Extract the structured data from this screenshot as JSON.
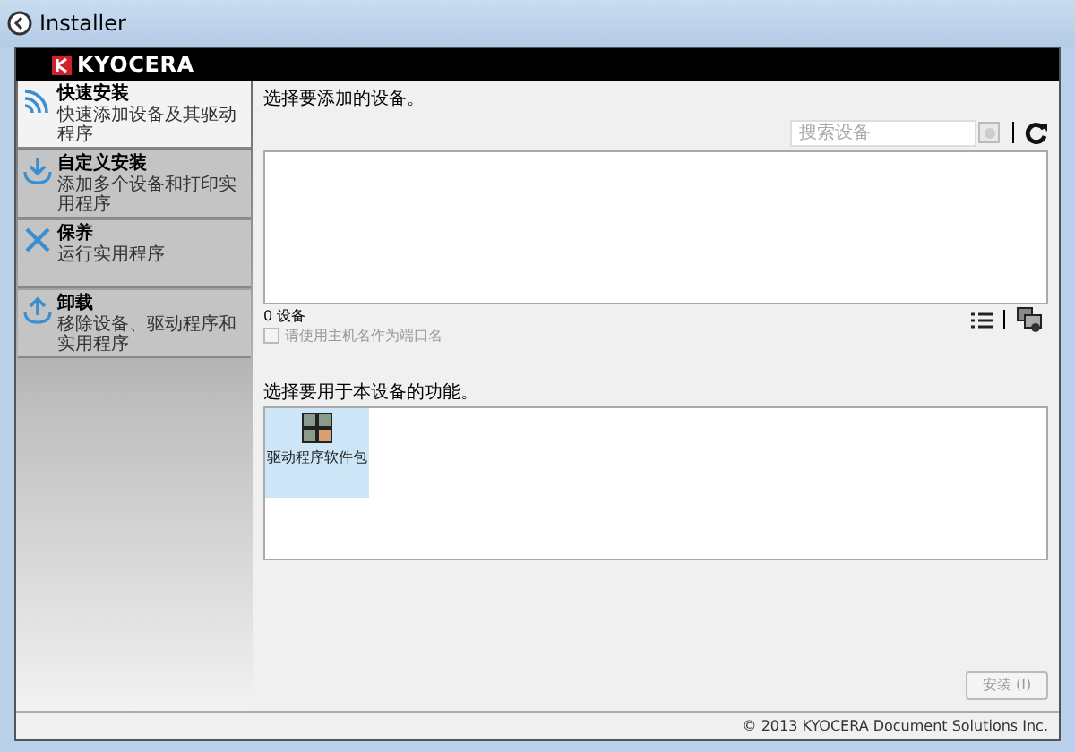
{
  "window": {
    "title": "Installer"
  },
  "logo": {
    "text": "KYOCERA"
  },
  "sidebar": {
    "items": [
      {
        "title": "快速安装",
        "subtitle": "快速添加设备及其驱动程序",
        "selected": true
      },
      {
        "title": "自定义安装",
        "subtitle": "添加多个设备和打印实用程序",
        "selected": false
      },
      {
        "title": "保养",
        "subtitle": "运行实用程序",
        "selected": false
      },
      {
        "title": "卸载",
        "subtitle": "移除设备、驱动程序和实用程序",
        "selected": false
      }
    ]
  },
  "devices": {
    "heading": "选择要添加的设备。",
    "search": {
      "placeholder": "搜索设备"
    },
    "count": "0 设备",
    "hostname_option": {
      "label": "请使用主机名作为端口名",
      "checked": false,
      "disabled": true
    }
  },
  "functions": {
    "heading": "选择要用于本设备的功能。",
    "items": [
      {
        "label": "驱动程序软件包",
        "selected": true
      }
    ]
  },
  "install_button": {
    "label": "安装 (I)",
    "disabled": true
  },
  "footer": {
    "copyright": "© 2013 KYOCERA Document Solutions Inc."
  }
}
